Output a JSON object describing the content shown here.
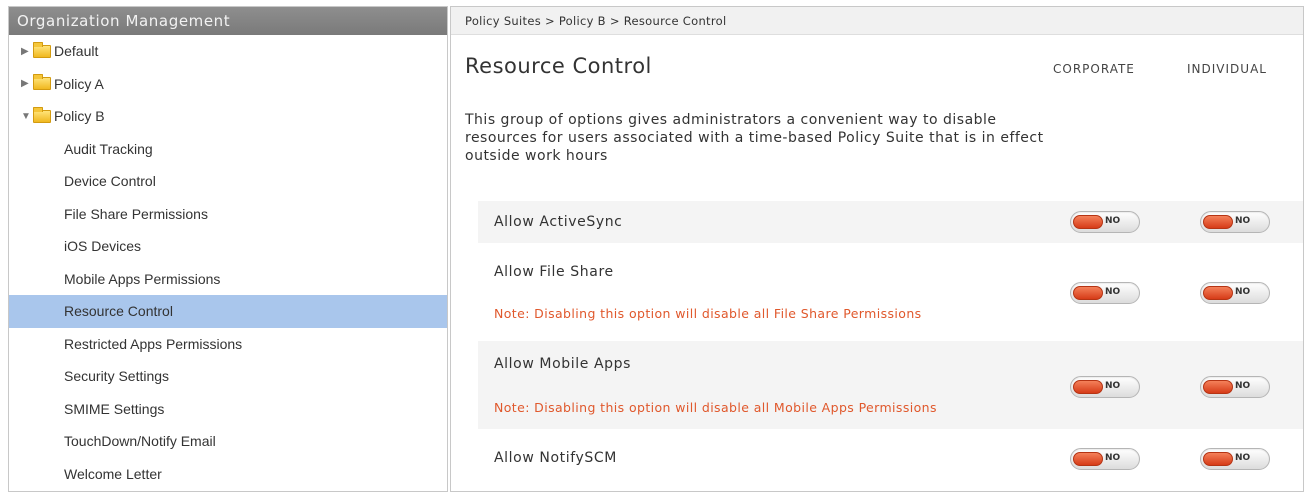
{
  "sidebar": {
    "title": "Organization Management",
    "top_items": [
      {
        "label": "Default",
        "expanded": false
      },
      {
        "label": "Policy A",
        "expanded": false
      },
      {
        "label": "Policy B",
        "expanded": true
      }
    ],
    "children": [
      "Audit Tracking",
      "Device Control",
      "File Share Permissions",
      "iOS Devices",
      "Mobile Apps Permissions",
      "Resource Control",
      "Restricted Apps Permissions",
      "Security Settings",
      "SMIME Settings",
      "TouchDown/Notify Email",
      "Welcome Letter"
    ],
    "selected": "Resource Control"
  },
  "breadcrumb": "Policy Suites > Policy B > Resource Control",
  "main": {
    "title": "Resource Control",
    "columns": [
      "CORPORATE",
      "INDIVIDUAL"
    ],
    "description": "This group of options gives administrators a convenient way to disable resources for users associated with a time-based Policy Suite that is in effect outside work hours",
    "options": [
      {
        "label": "Allow ActiveSync",
        "note": "",
        "corporate": "NO",
        "individual": "NO"
      },
      {
        "label": "Allow File Share",
        "note": "Note: Disabling this option will disable all File Share Permissions",
        "corporate": "NO",
        "individual": "NO"
      },
      {
        "label": "Allow Mobile Apps",
        "note": "Note: Disabling this option will disable all Mobile Apps Permissions",
        "corporate": "NO",
        "individual": "NO"
      },
      {
        "label": "Allow NotifySCM",
        "note": "",
        "corporate": "NO",
        "individual": "NO"
      }
    ]
  },
  "colors": {
    "header_bg": "#858585",
    "selected_bg": "#a9c6ec",
    "note_text": "#e0582c",
    "toggle_knob": "#e0582c"
  }
}
